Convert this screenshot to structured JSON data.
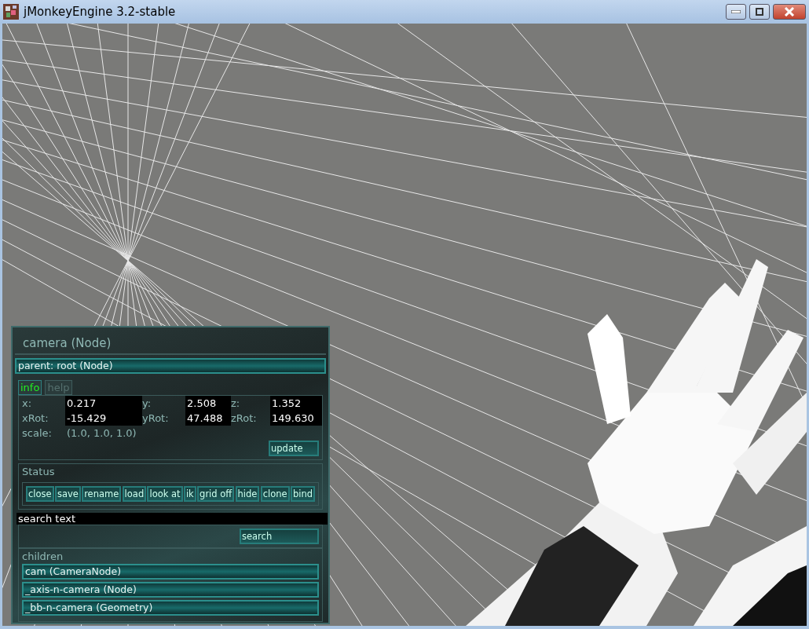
{
  "window": {
    "title": "jMonkeyEngine 3.2-stable"
  },
  "panel": {
    "title": "camera (Node)",
    "parent": "parent: root (Node)",
    "tabs": [
      {
        "label": "info",
        "selected": true
      },
      {
        "label": "help",
        "selected": false
      }
    ],
    "fields": [
      {
        "label": "x:",
        "value": "0.217"
      },
      {
        "label": "y:",
        "value": "2.508"
      },
      {
        "label": "z:",
        "value": "1.352"
      },
      {
        "label": "xRot:",
        "value": "-15.429"
      },
      {
        "label": "yRot:",
        "value": "47.488"
      },
      {
        "label": "zRot:",
        "value": "149.630"
      }
    ],
    "scale": {
      "label": "scale:",
      "value": "(1.0, 1.0, 1.0)"
    },
    "update_button": "update",
    "status_label": "Status",
    "actions": [
      "close",
      "save",
      "rename",
      "load",
      "look at",
      "ik",
      "grid off",
      "hide",
      "clone",
      "bind"
    ],
    "search": {
      "value": "search text",
      "button": "search"
    },
    "children_label": "children",
    "children": [
      "cam (CameraNode)",
      "_axis-n-camera (Node)",
      "_bb-n-camera (Geometry)"
    ]
  }
}
